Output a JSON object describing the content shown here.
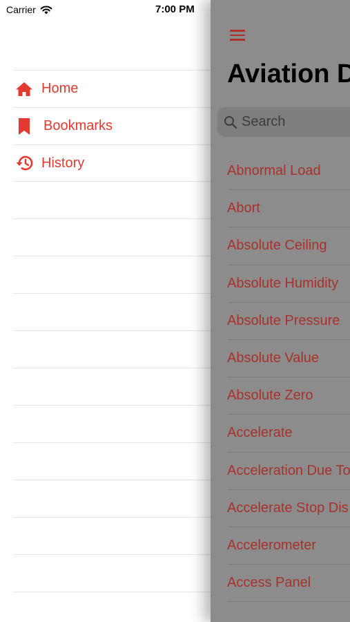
{
  "status_bar": {
    "carrier": "Carrier",
    "time": "7:00 PM"
  },
  "menu": {
    "items": [
      {
        "label": "Home",
        "icon": "home-icon"
      },
      {
        "label": "Bookmarks",
        "icon": "bookmark-icon"
      },
      {
        "label": "History",
        "icon": "history-icon"
      }
    ]
  },
  "main": {
    "title": "Aviation D",
    "search_placeholder": "Search",
    "terms": [
      "Abnormal Load",
      "Abort",
      "Absolute Ceiling",
      "Absolute Humidity",
      "Absolute Pressure",
      "Absolute Value",
      "Absolute Zero",
      "Accelerate",
      "Acceleration Due To",
      "Accelerate Stop Dis",
      "Accelerometer",
      "Access Panel"
    ]
  },
  "colors": {
    "accent": "#e33a2f",
    "accent_dimmed": "#a8322b",
    "overlay": "#8c8c8c"
  }
}
